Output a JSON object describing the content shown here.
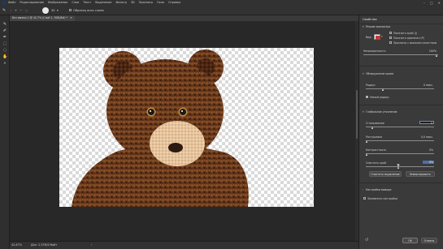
{
  "menubar": {
    "items": [
      "Файл",
      "Редактирование",
      "Изображение",
      "Слои",
      "Текст",
      "Выделение",
      "Фильтр",
      "3D",
      "Просмотр",
      "Окно",
      "Справка"
    ],
    "window_controls": [
      "–",
      "□",
      "✕"
    ]
  },
  "options": {
    "brush_size": "30",
    "sample_all_label": "Образец всех слоев",
    "brush_mode": "+"
  },
  "document": {
    "tab_label": "Без имени-1 @ 42,7% (Слой 1, RGB/8#) *",
    "zoom": "42,67%",
    "doc_info": "Док: 2,37M/0 байт"
  },
  "panel": {
    "title": "Свойства",
    "view_mode_label": "Режим просмотра",
    "view_label": "Вид:",
    "show_edge_label": "Показать край (J)",
    "show_original_label": "Показать оригинал (P)",
    "high_quality_label": "Просмотр с высоким качеством",
    "opacity_label": "Непрозрачность",
    "opacity_value": "100%",
    "edge_detection_label": "Обнаружение краев",
    "radius_label": "Радиус",
    "radius_value": "0 пикс.",
    "smart_radius_label": "Умный радиус",
    "global_refinement_label": "Глобальное уточнение",
    "smooth_label": "Сглаживание",
    "smooth_value": "0",
    "feather_label": "Растушевка",
    "feather_value": "0,0 пикс.",
    "contrast_label": "Контрастность",
    "contrast_value": "0%",
    "shift_edge_label": "Сместить край",
    "shift_edge_value": "0%",
    "clear_selection_button": "Очистить выделение",
    "invert_button": "Инвертировать",
    "output_settings_label": "Настройки вывода",
    "remember_settings_label": "Запомнить настройки",
    "ok_button": "OK",
    "cancel_button": "Отмена"
  },
  "colors": {
    "fur_dark": "#3b1e0e",
    "fur_mid": "#6b3a1c",
    "fur_light": "#8a5228",
    "muzzle": "#e6c49c",
    "nose": "#2a1a10",
    "eye": "#1a1a1a",
    "eye_ring": "#c98c3c",
    "accent_blue": "#4b6fa8"
  }
}
